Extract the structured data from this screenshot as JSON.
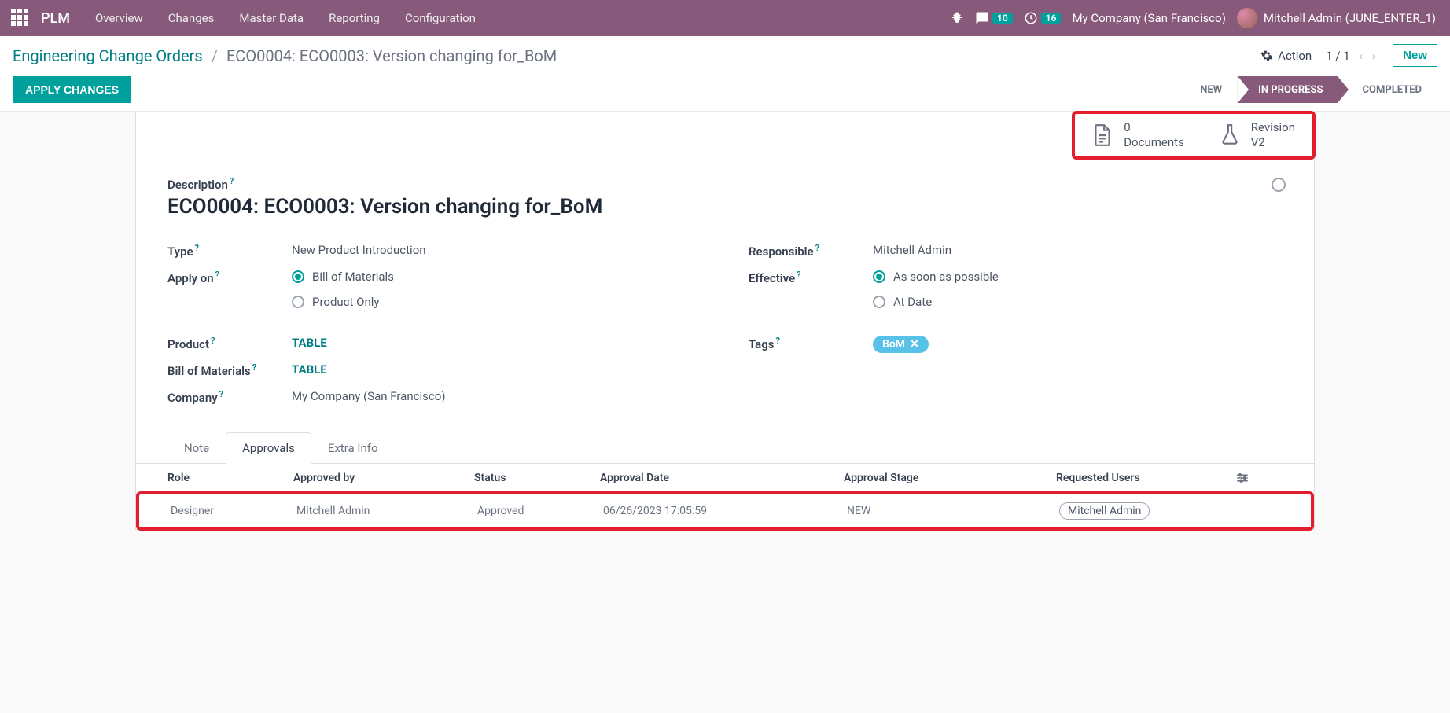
{
  "topnav": {
    "brand": "PLM",
    "menu": [
      "Overview",
      "Changes",
      "Master Data",
      "Reporting",
      "Configuration"
    ],
    "messages_badge": "10",
    "activities_badge": "16",
    "company": "My Company (San Francisco)",
    "user": "Mitchell Admin (JUNE_ENTER_1)"
  },
  "breadcrumb": {
    "root": "Engineering Change Orders",
    "current": "ECO0004: ECO0003: Version changing for_BoM"
  },
  "controls": {
    "action_label": "Action",
    "pager": "1 / 1",
    "new_label": "New"
  },
  "statusbar": {
    "apply_label": "APPLY CHANGES",
    "stages": [
      "NEW",
      "IN PROGRESS",
      "COMPLETED"
    ],
    "active_index": 1
  },
  "stat_buttons": {
    "docs_count": "0",
    "docs_label": "Documents",
    "rev_label": "Revision",
    "rev_value": "V2"
  },
  "form": {
    "description_label": "Description",
    "title": "ECO0004: ECO0003: Version changing for_BoM",
    "labels": {
      "type": "Type",
      "apply_on": "Apply on",
      "product": "Product",
      "bom": "Bill of Materials",
      "company": "Company",
      "responsible": "Responsible",
      "effective": "Effective",
      "tags": "Tags"
    },
    "values": {
      "type": "New Product Introduction",
      "apply_on_options": [
        "Bill of Materials",
        "Product Only"
      ],
      "apply_on_selected": 0,
      "product": "TABLE",
      "bom": "TABLE",
      "company": "My Company (San Francisco)",
      "responsible": "Mitchell Admin",
      "effective_options": [
        "As soon as possible",
        "At Date"
      ],
      "effective_selected": 0,
      "tag": "BoM"
    }
  },
  "tabs": [
    "Note",
    "Approvals",
    "Extra Info"
  ],
  "tabs_active": 1,
  "table": {
    "headers": [
      "Role",
      "Approved by",
      "Status",
      "Approval Date",
      "Approval Stage",
      "Requested Users"
    ],
    "row": {
      "role": "Designer",
      "approved_by": "Mitchell Admin",
      "status": "Approved",
      "date": "06/26/2023 17:05:59",
      "stage": "NEW",
      "requested": "Mitchell Admin"
    }
  }
}
